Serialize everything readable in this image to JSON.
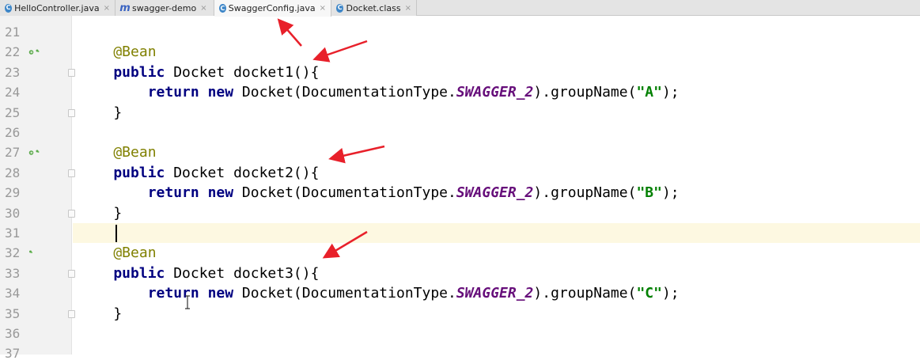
{
  "tabs": [
    {
      "label": "HelloController.java",
      "icon": "class-icon",
      "icon_letter": "C",
      "active": false
    },
    {
      "label": "swagger-demo",
      "icon": "module-icon",
      "icon_letter": "m",
      "active": false
    },
    {
      "label": "SwaggerConfig.java",
      "icon": "class-icon",
      "icon_letter": "C",
      "active": true
    },
    {
      "label": "Docket.class",
      "icon": "class-icon",
      "icon_letter": "C",
      "active": false
    }
  ],
  "close_glyph": "×",
  "editor": {
    "lines": [
      {
        "num": "21",
        "tokens": []
      },
      {
        "num": "22",
        "bean_icon": true,
        "tokens": [
          {
            "t": "    @Bean",
            "c": "ann"
          }
        ]
      },
      {
        "num": "23",
        "fold": true,
        "tokens": [
          {
            "t": "    public",
            "c": "kw"
          },
          {
            "t": " Docket docket1(){",
            "c": ""
          }
        ]
      },
      {
        "num": "24",
        "tokens": [
          {
            "t": "        return",
            "c": "kw"
          },
          {
            "t": " ",
            "c": ""
          },
          {
            "t": "new",
            "c": "kw"
          },
          {
            "t": " Docket(DocumentationType.",
            "c": ""
          },
          {
            "t": "SWAGGER_2",
            "c": "const"
          },
          {
            "t": ").groupName(",
            "c": ""
          },
          {
            "t": "\"A\"",
            "c": "str"
          },
          {
            "t": ");",
            "c": ""
          }
        ]
      },
      {
        "num": "25",
        "fold": true,
        "tokens": [
          {
            "t": "    }",
            "c": ""
          }
        ]
      },
      {
        "num": "26",
        "tokens": []
      },
      {
        "num": "27",
        "bean_icon": true,
        "tokens": [
          {
            "t": "    @Bean",
            "c": "ann"
          }
        ]
      },
      {
        "num": "28",
        "fold": true,
        "tokens": [
          {
            "t": "    public",
            "c": "kw"
          },
          {
            "t": " Docket docket2(){",
            "c": ""
          }
        ]
      },
      {
        "num": "29",
        "tokens": [
          {
            "t": "        return",
            "c": "kw"
          },
          {
            "t": " ",
            "c": ""
          },
          {
            "t": "new",
            "c": "kw"
          },
          {
            "t": " Docket(DocumentationType.",
            "c": ""
          },
          {
            "t": "SWAGGER_2",
            "c": "const"
          },
          {
            "t": ").groupName(",
            "c": ""
          },
          {
            "t": "\"B\"",
            "c": "str"
          },
          {
            "t": ");",
            "c": ""
          }
        ]
      },
      {
        "num": "30",
        "fold": true,
        "tokens": [
          {
            "t": "    }",
            "c": ""
          }
        ]
      },
      {
        "num": "31",
        "caret": true,
        "tokens": []
      },
      {
        "num": "32",
        "bean_icon_small": true,
        "tokens": [
          {
            "t": "    @Bean",
            "c": "ann"
          }
        ]
      },
      {
        "num": "33",
        "fold": true,
        "tokens": [
          {
            "t": "    public",
            "c": "kw"
          },
          {
            "t": " Docket docket3(){",
            "c": ""
          }
        ]
      },
      {
        "num": "34",
        "tokens": [
          {
            "t": "        return",
            "c": "kw"
          },
          {
            "t": " ",
            "c": ""
          },
          {
            "t": "new",
            "c": "kw"
          },
          {
            "t": " Docket(DocumentationType.",
            "c": ""
          },
          {
            "t": "SWAGGER_2",
            "c": "const"
          },
          {
            "t": ").groupName(",
            "c": ""
          },
          {
            "t": "\"C\"",
            "c": "str"
          },
          {
            "t": ");",
            "c": ""
          }
        ]
      },
      {
        "num": "35",
        "fold": true,
        "tokens": [
          {
            "t": "    }",
            "c": ""
          }
        ]
      },
      {
        "num": "36",
        "tokens": []
      },
      {
        "num": "37",
        "tokens": []
      }
    ]
  },
  "colors": {
    "annotation": "#808000",
    "keyword": "#000080",
    "constant": "#660e7a",
    "string": "#008000",
    "arrow": "#e8202a",
    "caret_row": "#fdf8e1"
  }
}
